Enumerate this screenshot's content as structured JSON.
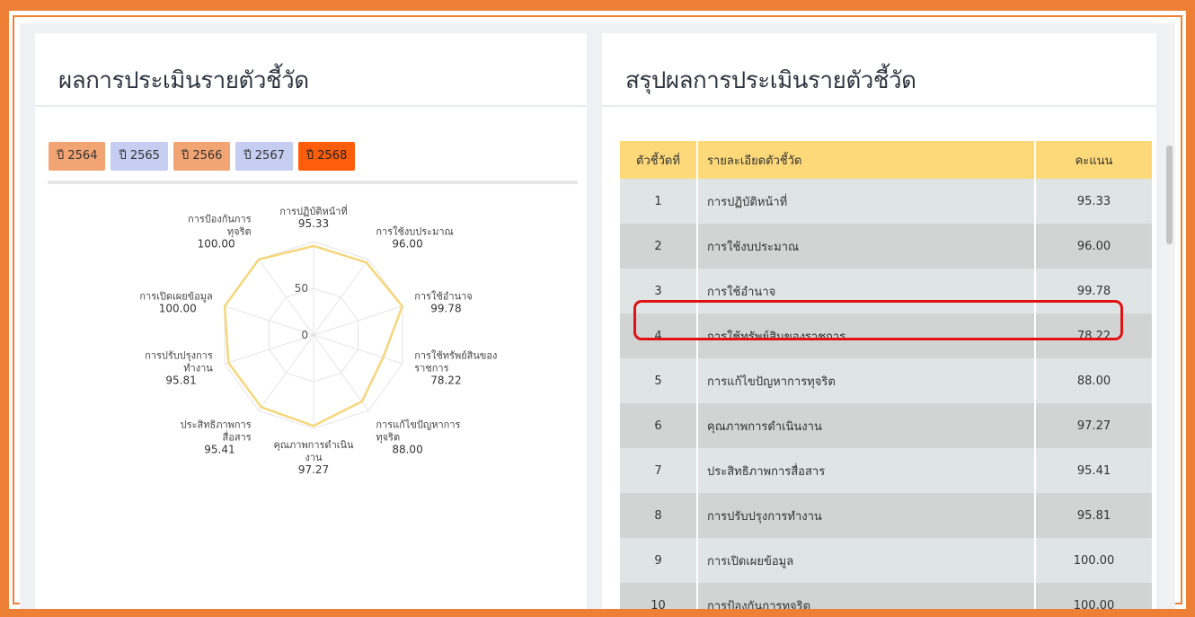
{
  "left_panel": {
    "title": "ผลการประเมินรายตัวชี้วัด",
    "year_tabs": [
      {
        "label": "ปี 2564",
        "style": "orange"
      },
      {
        "label": "ปี 2565",
        "style": "blue"
      },
      {
        "label": "ปี 2566",
        "style": "orange"
      },
      {
        "label": "ปี 2567",
        "style": "blue"
      },
      {
        "label": "ปี 2568",
        "style": "active"
      }
    ],
    "active_year": "ปี 2568"
  },
  "chart_data": {
    "type": "radar",
    "title": "",
    "range": [
      0,
      100
    ],
    "ring_labels": [
      "0",
      "50"
    ],
    "line_color": "#f5d67a",
    "axes": [
      {
        "label": [
          "การปฏิบัติหน้าที่"
        ],
        "value": 95.33,
        "value_text": "95.33"
      },
      {
        "label": [
          "การใช้งบประมาณ"
        ],
        "value": 96.0,
        "value_text": "96.00"
      },
      {
        "label": [
          "การใช้อำนาจ"
        ],
        "value": 99.78,
        "value_text": "99.78"
      },
      {
        "label": [
          "การใช้ทรัพย์สินของ",
          "ราชการ"
        ],
        "value": 78.22,
        "value_text": "78.22"
      },
      {
        "label": [
          "การแก้ไขปัญหาการ",
          "ทุจริต"
        ],
        "value": 88.0,
        "value_text": "88.00"
      },
      {
        "label": [
          "คุณภาพการดำเนิน",
          "งาน"
        ],
        "value": 97.27,
        "value_text": "97.27"
      },
      {
        "label": [
          "ประสิทธิภาพการ",
          "สื่อสาร"
        ],
        "value": 95.41,
        "value_text": "95.41"
      },
      {
        "label": [
          "การปรับปรุงการ",
          "ทำงาน"
        ],
        "value": 95.81,
        "value_text": "95.81"
      },
      {
        "label": [
          "การเปิดเผยข้อมูล"
        ],
        "value": 100.0,
        "value_text": "100.00"
      },
      {
        "label": [
          "การป้องกันการ",
          "ทุจริต"
        ],
        "value": 100.0,
        "value_text": "100.00"
      }
    ]
  },
  "right_panel": {
    "title": "สรุปผลการประเมินรายตัวชี้วัด",
    "table": {
      "headers": [
        "ตัวชี้วัดที่",
        "รายละเอียดตัวชี้วัด",
        "คะแนน"
      ],
      "rows": [
        {
          "num": "1",
          "name": "การปฏิบัติหน้าที่",
          "score": "95.33"
        },
        {
          "num": "2",
          "name": "การใช้งบประมาณ",
          "score": "96.00"
        },
        {
          "num": "3",
          "name": "การใช้อำนาจ",
          "score": "99.78"
        },
        {
          "num": "4",
          "name": "การใช้ทรัพย์สินของราชการ",
          "score": "78.22"
        },
        {
          "num": "5",
          "name": "การแก้ไขปัญหาการทุจริต",
          "score": "88.00"
        },
        {
          "num": "6",
          "name": "คุณภาพการดำเนินงาน",
          "score": "97.27"
        },
        {
          "num": "7",
          "name": "ประสิทธิภาพการสื่อสาร",
          "score": "95.41"
        },
        {
          "num": "8",
          "name": "การปรับปรุงการทำงาน",
          "score": "95.81"
        },
        {
          "num": "9",
          "name": "การเปิดเผยข้อมูล",
          "score": "100.00"
        },
        {
          "num": "10",
          "name": "การป้องกันการทุจริต",
          "score": "100.00"
        }
      ]
    },
    "highlighted_row": "4"
  }
}
